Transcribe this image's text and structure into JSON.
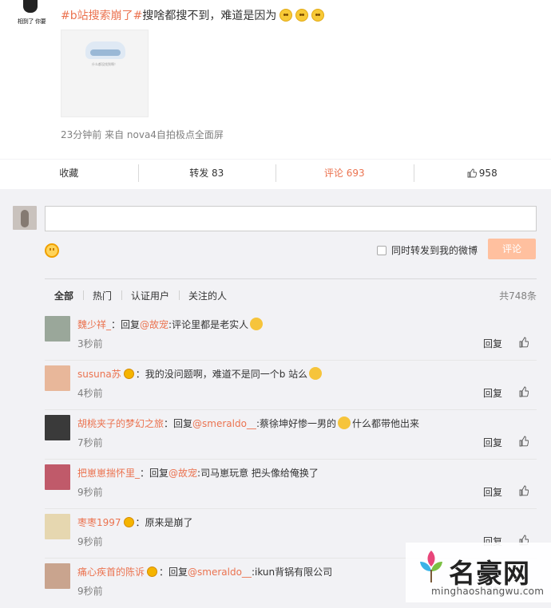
{
  "post": {
    "avatar_caption": "相到了 你要",
    "hashtag": "#b站搜索崩了#",
    "text": "搜啥都搜不到，难道是因为",
    "image_caption": "什么都没找到啊！",
    "meta": "23分钟前 来自 nova4自拍极点全面屏"
  },
  "actions": {
    "favorite": "收藏",
    "repost": "转发 83",
    "comment": "评论 693",
    "like_count": "958"
  },
  "composer": {
    "placeholder": "",
    "sync_label": "同时转发到我的微博",
    "submit_label": "评论"
  },
  "filters": {
    "items": [
      "全部",
      "热门",
      "认证用户",
      "关注的人"
    ],
    "count": "共748条"
  },
  "comments": [
    {
      "user": "魏少祥_",
      "prefix": "：回复",
      "mention": "@故宠",
      "text": ":评论里都是老实人",
      "time": "3秒前",
      "reply": "回复",
      "avatar_color": "#9aa79a"
    },
    {
      "user": "susuna苏",
      "prefix": "：我的没问题啊，难道不是同一个b 站么",
      "mention": "",
      "text": "",
      "time": "4秒前",
      "reply": "回复",
      "avatar_color": "#e8b79a"
    },
    {
      "user": "胡桃夹子的梦幻之旅",
      "prefix": "：回复",
      "mention": "@smeraldo__",
      "text": ":蔡徐坤好惨一男的",
      "text2": "什么都带他出来",
      "time": "7秒前",
      "reply": "回复",
      "avatar_color": "#3a3a3a"
    },
    {
      "user": "把崽崽揣怀里_",
      "prefix": "：回复",
      "mention": "@故宠",
      "text": ":司马崽玩意 把头像给俺换了",
      "time": "9秒前",
      "reply": "回复",
      "avatar_color": "#c05a6a"
    },
    {
      "user": "枣枣1997",
      "prefix": "：原来是崩了",
      "mention": "",
      "text": "",
      "time": "9秒前",
      "reply": "回复",
      "avatar_color": "#e6d7b0"
    },
    {
      "user": "痛心疾首的陈诉",
      "prefix": "：回复",
      "mention": "@smeraldo__",
      "text": ":ikun背锅有限公司",
      "time": "9秒前",
      "reply": "回复",
      "avatar_color": "#c9a48e"
    }
  ],
  "watermark": {
    "name": "名豪网",
    "url": "minghaoshangwu.com"
  }
}
